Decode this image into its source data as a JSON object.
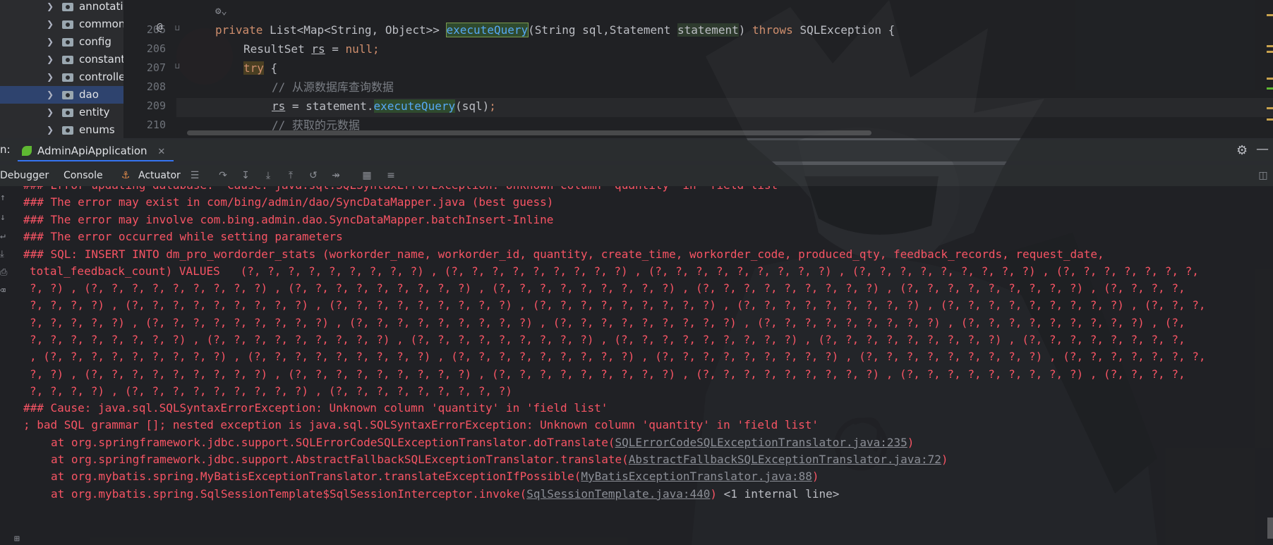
{
  "colors": {
    "error_text": "#f75464",
    "keyword": "#cf8e6d",
    "function": "#56a8f5",
    "comment": "#7a7e85",
    "selection": "#2e436e"
  },
  "tree": {
    "items": [
      {
        "label": "annotatio"
      },
      {
        "label": "common"
      },
      {
        "label": "config"
      },
      {
        "label": "constant"
      },
      {
        "label": "controlle"
      },
      {
        "label": "dao",
        "selected": true
      },
      {
        "label": "entity"
      },
      {
        "label": "enums"
      }
    ]
  },
  "editor": {
    "lines": [
      {
        "num": "205",
        "kw1": "private ",
        "t1": "List<Map<String, Object>> ",
        "fn": "executeQuery",
        "t2": "(String sql,Statement ",
        "param": "statement",
        "t3": ") ",
        "kw2": "throws ",
        "t4": "SQLException {"
      },
      {
        "num": "206",
        "t1": "ResultSet ",
        "var": "rs",
        "t2": " = ",
        "kw1": "null",
        "t3": ";"
      },
      {
        "num": "207",
        "kw1": "try",
        "t1": " {"
      },
      {
        "num": "208",
        "comment": "// 从源数据库查询数据"
      },
      {
        "num": "209",
        "var": "rs",
        "t1": " = statement.",
        "fn": "executeQuery",
        "t2": "(sql)",
        "t3": ";"
      },
      {
        "num": "210",
        "comment": "// 获取的元数据"
      }
    ]
  },
  "run": {
    "panel_label": "n:",
    "tab_label": "AdminApiApplication",
    "toolbar": {
      "debugger": "Debugger",
      "console": "Console",
      "actuator": "Actuator"
    }
  },
  "console": {
    "lines": [
      {
        "text": "### Error updating database.  Cause: java.sql.SQLSyntaxErrorException: Unknown column 'quantity' in 'field list'"
      },
      {
        "text": "### The error may exist in com/bing/admin/dao/SyncDataMapper.java (best guess)"
      },
      {
        "text": "### The error may involve com.bing.admin.dao.SyncDataMapper.batchInsert-Inline"
      },
      {
        "text": "### The error occurred while setting parameters"
      },
      {
        "text": "### SQL: INSERT INTO dm_pro_wordorder_stats (workorder_name, workorder_id, quantity, create_time, workorder_code, produced_qty, feedback_records, request_date,"
      },
      {
        "text": "total_feedback_count) VALUES   (?, ?, ?, ?, ?, ?, ?, ?, ?) , (?, ?, ?, ?, ?, ?, ?, ?, ?) , (?, ?, ?, ?, ?, ?, ?, ?, ?) , (?, ?, ?, ?, ?, ?, ?, ?, ?) , (?, ?, ?, ?, ?, ?, ?,"
      },
      {
        "text": "?, ?) , (?, ?, ?, ?, ?, ?, ?, ?, ?) , (?, ?, ?, ?, ?, ?, ?, ?, ?) , (?, ?, ?, ?, ?, ?, ?, ?, ?) , (?, ?, ?, ?, ?, ?, ?, ?, ?) , (?, ?, ?, ?, ?, ?, ?, ?, ?) , (?, ?, ?, ?,"
      },
      {
        "text": "?, ?, ?, ?) , (?, ?, ?, ?, ?, ?, ?, ?, ?) , (?, ?, ?, ?, ?, ?, ?, ?, ?) , (?, ?, ?, ?, ?, ?, ?, ?, ?) , (?, ?, ?, ?, ?, ?, ?, ?, ?) , (?, ?, ?, ?, ?, ?, ?, ?, ?) , (?, ?, ?,"
      },
      {
        "text": "?, ?, ?, ?, ?) , (?, ?, ?, ?, ?, ?, ?, ?, ?) , (?, ?, ?, ?, ?, ?, ?, ?, ?) , (?, ?, ?, ?, ?, ?, ?, ?, ?) , (?, ?, ?, ?, ?, ?, ?, ?, ?) , (?, ?, ?, ?, ?, ?, ?, ?, ?) , (?,"
      },
      {
        "text": "?, ?, ?, ?, ?, ?, ?, ?) , (?, ?, ?, ?, ?, ?, ?, ?, ?) , (?, ?, ?, ?, ?, ?, ?, ?, ?) , (?, ?, ?, ?, ?, ?, ?, ?, ?) , (?, ?, ?, ?, ?, ?, ?, ?, ?) , (?, ?, ?, ?, ?, ?, ?, ?,"
      },
      {
        "text": ", (?, ?, ?, ?, ?, ?, ?, ?, ?) , (?, ?, ?, ?, ?, ?, ?, ?, ?) , (?, ?, ?, ?, ?, ?, ?, ?, ?) , (?, ?, ?, ?, ?, ?, ?, ?, ?) , (?, ?, ?, ?, ?, ?, ?, ?, ?) , (?, ?, ?, ?, ?, ?, ?,"
      },
      {
        "text": "?, ?) , (?, ?, ?, ?, ?, ?, ?, ?, ?) , (?, ?, ?, ?, ?, ?, ?, ?, ?) , (?, ?, ?, ?, ?, ?, ?, ?, ?) , (?, ?, ?, ?, ?, ?, ?, ?, ?) , (?, ?, ?, ?, ?, ?, ?, ?, ?) , (?, ?, ?, ?,"
      },
      {
        "text": "?, ?, ?, ?) , (?, ?, ?, ?, ?, ?, ?, ?, ?) , (?, ?, ?, ?, ?, ?, ?, ?, ?)"
      },
      {
        "text": "### Cause: java.sql.SQLSyntaxErrorException: Unknown column 'quantity' in 'field list'"
      },
      {
        "text": "; bad SQL grammar []; nested exception is java.sql.SQLSyntaxErrorException: Unknown column 'quantity' in 'field list'"
      }
    ],
    "stack": [
      {
        "prefix": "at org.springframework.jdbc.support.SQLErrorCodeSQLExceptionTranslator.doTranslate(",
        "link": "SQLErrorCodeSQLExceptionTranslator.java:235",
        "suffix": ")"
      },
      {
        "prefix": "at org.springframework.jdbc.support.AbstractFallbackSQLExceptionTranslator.translate(",
        "link": "AbstractFallbackSQLExceptionTranslator.java:72",
        "suffix": ")"
      },
      {
        "prefix": "at org.mybatis.spring.MyBatisExceptionTranslator.translateExceptionIfPossible(",
        "link": "MyBatisExceptionTranslator.java:88",
        "suffix": ")"
      },
      {
        "prefix": "at org.mybatis.spring.SqlSessionTemplate$SqlSessionInterceptor.invoke(",
        "link": "SqlSessionTemplate.java:440",
        "suffix": ")",
        "extra": " <1 internal line>"
      }
    ]
  }
}
